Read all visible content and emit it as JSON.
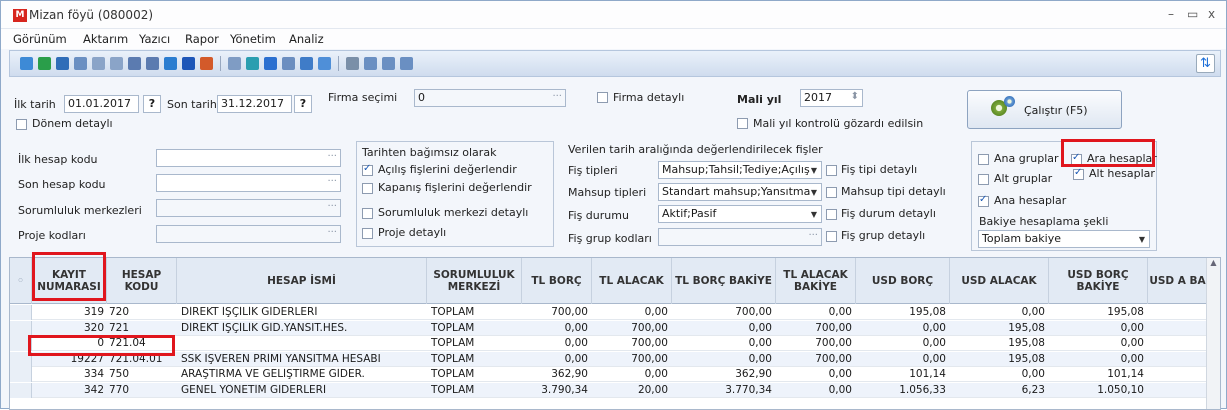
{
  "window": {
    "title": "Mizan föyü (080002)",
    "minimize": "–",
    "restore": "▭",
    "close": "x",
    "app_icon": "M"
  },
  "menu": [
    "Görünüm",
    "Aktarım",
    "Yazıcı",
    "Rapor",
    "Yönetim",
    "Analiz"
  ],
  "filters": {
    "ilk_tarih_label": "İlk tarih",
    "ilk_tarih": "01.01.2017",
    "son_tarih_label": "Son tarih",
    "son_tarih": "31.12.2017",
    "q": "?",
    "firma_secimi_label": "Firma seçimi",
    "firma_secimi": "0",
    "firma_detayli": "Firma detaylı",
    "mali_yil_label": "Mali yıl",
    "mali_yil": "2017",
    "mali_yil_kontrol": "Mali yıl kontrolü gözardı edilsin",
    "donem_detayli": "Dönem detaylı",
    "ilk_hesap_kodu": "İlk hesap kodu",
    "son_hesap_kodu": "Son hesap kodu",
    "sorumluluk_merkezleri": "Sorumluluk merkezleri",
    "proje_kodlari": "Proje kodları",
    "ellipsis": "···",
    "tarihten_title": "Tarihten bağımsız olarak",
    "acilis": "Açılış fişlerini değerlendir",
    "kapanis": "Kapanış fişlerini değerlendir",
    "sorumluluk_detayli": "Sorumluluk merkezi detaylı",
    "proje_detayli": "Proje detaylı",
    "verilen_title": "Verilen tarih aralığında değerlendirilecek fişler",
    "fis_tipleri_label": "Fiş tipleri",
    "fis_tipleri": "Mahsup;Tahsil;Tediye;Açılış",
    "fis_tipi_detayli": "Fiş tipi detaylı",
    "mahsup_tipleri_label": "Mahsup tipleri",
    "mahsup_tipleri": "Standart mahsup;Yansıtma",
    "mahsup_tipi_detayli": "Mahsup tipi detaylı",
    "fis_durumu_label": "Fiş durumu",
    "fis_durumu": "Aktif;Pasif",
    "fis_durum_detayli": "Fiş durum detaylı",
    "fis_grup_label": "Fiş grup kodları",
    "fis_grup_detayli": "Fiş grup detaylı",
    "calistir": "Çalıştır (F5)",
    "ana_gruplar": "Ana gruplar",
    "ara_hesaplar": "Ara hesaplar",
    "alt_gruplar": "Alt gruplar",
    "alt_hesaplar": "Alt hesaplar",
    "ana_hesaplar": "Ana hesaplar",
    "bakiye_label": "Bakiye hesaplama şekli",
    "bakiye": "Toplam bakiye"
  },
  "grid": {
    "columns": [
      "KAYIT NUMARASI",
      "HESAP KODU",
      "HESAP İSMİ",
      "SORUMLULUK MERKEZİ",
      "TL BORÇ",
      "TL ALACAK",
      "TL BORÇ BAKİYE",
      "TL ALACAK BAKİYE",
      "USD BORÇ",
      "USD ALACAK",
      "USD BORÇ BAKİYE",
      "USD A BA"
    ],
    "rows": [
      [
        "319",
        "720",
        "DİREKT İŞÇİLİK GİDERLERİ",
        "TOPLAM",
        "700,00",
        "0,00",
        "700,00",
        "0,00",
        "195,08",
        "0,00",
        "195,08"
      ],
      [
        "320",
        "721",
        "DİREKT İŞÇİLİK GİD.YANSIT.HES.",
        "TOPLAM",
        "0,00",
        "700,00",
        "0,00",
        "700,00",
        "0,00",
        "195,08",
        "0,00"
      ],
      [
        "0",
        "721.04",
        "",
        "TOPLAM",
        "0,00",
        "700,00",
        "0,00",
        "700,00",
        "0,00",
        "195,08",
        "0,00"
      ],
      [
        "19227",
        "721.04.01",
        "SSK İŞVEREN PRİMİ YANSITMA HESABI",
        "TOPLAM",
        "0,00",
        "700,00",
        "0,00",
        "700,00",
        "0,00",
        "195,08",
        "0,00"
      ],
      [
        "334",
        "750",
        "ARAŞTIRMA VE GELİŞTİRME GİDER.",
        "TOPLAM",
        "362,90",
        "0,00",
        "362,90",
        "0,00",
        "101,14",
        "0,00",
        "101,14"
      ],
      [
        "342",
        "770",
        "GENEL YÖNETİM GİDERLERİ",
        "TOPLAM",
        "3.790,34",
        "20,00",
        "3.770,34",
        "0,00",
        "1.056,33",
        "6,23",
        "1.050,10"
      ]
    ]
  }
}
